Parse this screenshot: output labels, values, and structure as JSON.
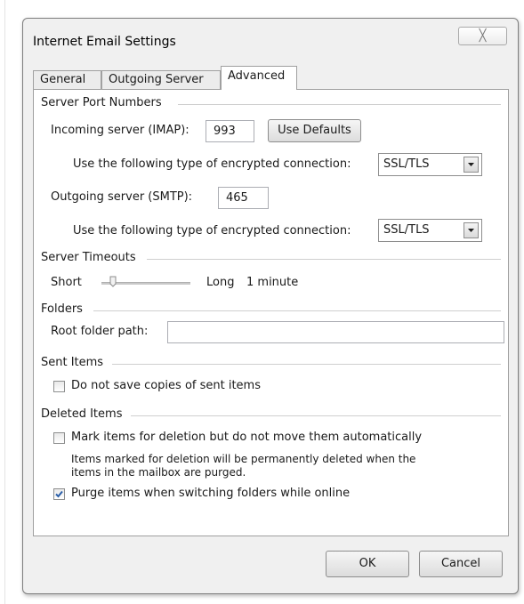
{
  "dialog": {
    "title": "Internet Email Settings",
    "close_glyph": "╳"
  },
  "tabs": [
    {
      "label": "General",
      "active": false
    },
    {
      "label": "Outgoing Server",
      "active": false
    },
    {
      "label": "Advanced",
      "active": true
    }
  ],
  "server_ports": {
    "heading": "Server Port Numbers",
    "incoming_label": "Incoming server (IMAP):",
    "incoming_value": "993",
    "use_defaults_label": "Use Defaults",
    "incoming_encryption_label": "Use the following type of encrypted connection:",
    "incoming_encryption_value": "SSL/TLS",
    "outgoing_label": "Outgoing server (SMTP):",
    "outgoing_value": "465",
    "outgoing_encryption_label": "Use the following type of encrypted connection:",
    "outgoing_encryption_value": "SSL/TLS"
  },
  "timeouts": {
    "heading": "Server Timeouts",
    "short_label": "Short",
    "long_label": "Long",
    "value_label": "1 minute",
    "slider_level": 0.1
  },
  "folders": {
    "heading": "Folders",
    "root_label": "Root folder path:",
    "root_value": ""
  },
  "sent_items": {
    "heading": "Sent Items",
    "dont_save_label": "Do not save copies of sent items",
    "dont_save_checked": false
  },
  "deleted_items": {
    "heading": "Deleted Items",
    "mark_label": "Mark items for deletion but do not move them automatically",
    "mark_checked": false,
    "note_line1": "Items marked for deletion will be permanently deleted when the",
    "note_line2": "items in the mailbox are purged.",
    "purge_label": "Purge items when switching folders while online",
    "purge_checked": true
  },
  "footer": {
    "ok_label": "OK",
    "cancel_label": "Cancel"
  },
  "colors": {
    "dialog_bg": "#f0f0f0",
    "panel_bg": "#ffffff",
    "checkmark": "#2a5ea8"
  }
}
